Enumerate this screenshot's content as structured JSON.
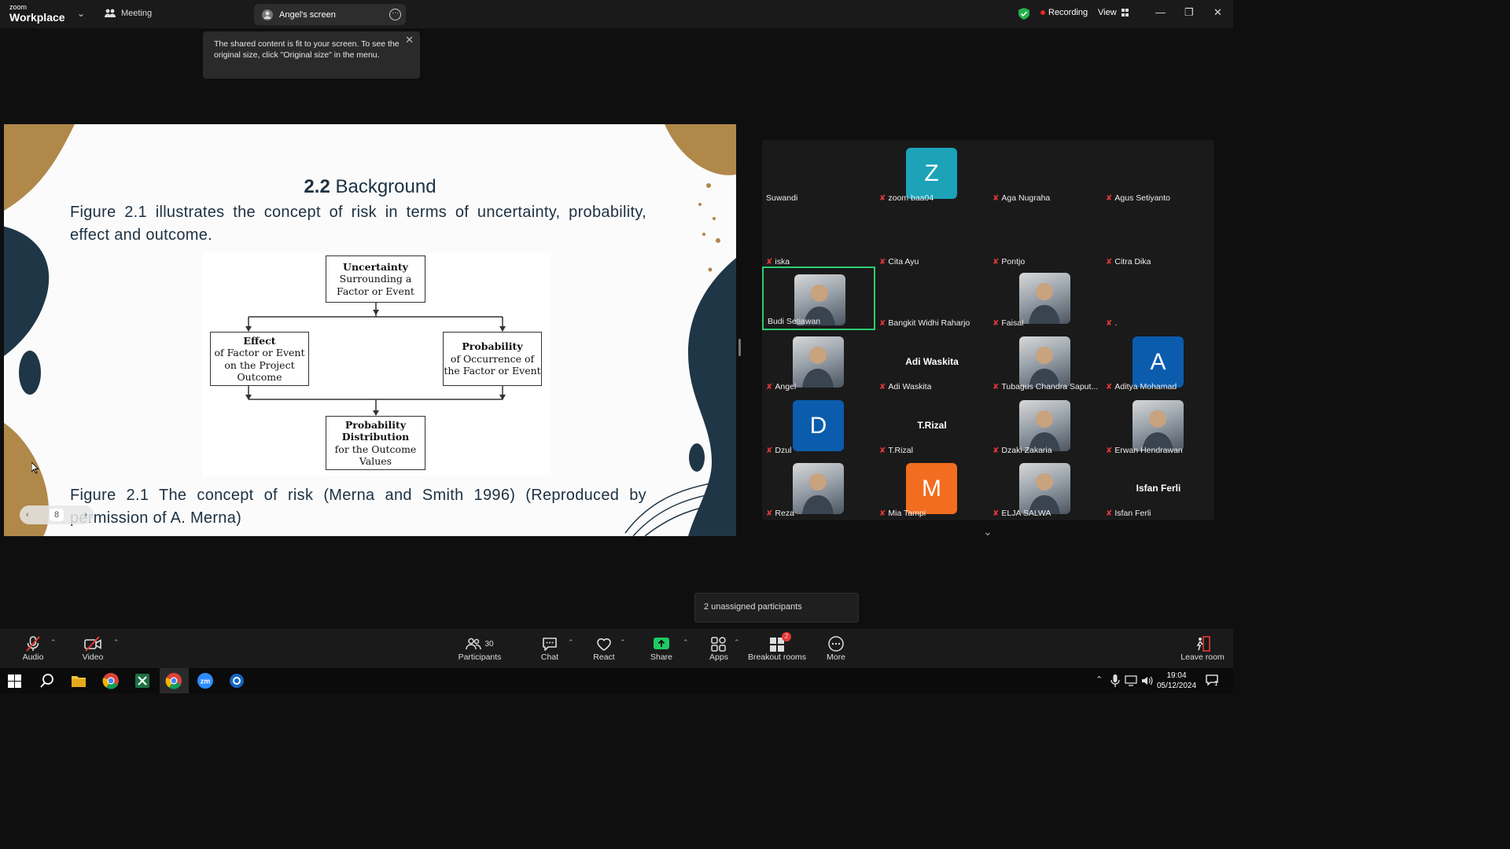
{
  "app": {
    "logo_top": "zoom",
    "logo_bottom": "Workplace"
  },
  "topbar": {
    "meeting_label": "Meeting",
    "screen_label": "Angel's screen",
    "recording_label": "Recording",
    "view_label": "View"
  },
  "tooltip": {
    "text": "The shared content is fit to your screen. To see the original size, click \"Original size\" in the menu."
  },
  "slide": {
    "title_num": "2.2",
    "title_text": "Background",
    "paragraph": "Figure 2.1 illustrates the concept of risk in terms of uncertainty, probability, effect and outcome.",
    "caption": "Figure 2.1 The concept of risk (Merna and Smith 1996) (Reproduced by permission of A. Merna)",
    "page_number": "8",
    "diagram": {
      "box1_bold": "Uncertainty",
      "box1_rest": "Surrounding a Factor or Event",
      "box2_bold": "Effect",
      "box2_rest": "of Factor or Event on the Project Outcome",
      "box3_bold": "Probability",
      "box3_rest": "of Occurrence of the Factor or Event",
      "box4_bold": "Probability Distribution",
      "box4_rest": "for the Outcome Values"
    }
  },
  "participants": [
    {
      "name": "Suwandi",
      "muted": false
    },
    {
      "name": "zoom baa04",
      "muted": true,
      "avatar": "Z",
      "color": "#1ca3b8"
    },
    {
      "name": "Aga Nugraha",
      "muted": true
    },
    {
      "name": "Agus Setiyanto",
      "muted": true
    },
    {
      "name": "iska",
      "muted": true
    },
    {
      "name": "Cita Ayu",
      "muted": true
    },
    {
      "name": "Pontjo",
      "muted": true
    },
    {
      "name": "Citra Dika",
      "muted": true
    },
    {
      "name": "Budi Setiawan",
      "muted": false,
      "active": true,
      "photo": true
    },
    {
      "name": "Bangkit Widhi Raharjo",
      "muted": true
    },
    {
      "name": "Faisal",
      "muted": true,
      "photo": true
    },
    {
      "name": ".",
      "muted": true
    },
    {
      "name": "Angel",
      "muted": true,
      "photo": true
    },
    {
      "name": "Adi Waskita",
      "muted": true,
      "display": "Adi Waskita"
    },
    {
      "name": "Tubagus Chandra Saput...",
      "muted": true,
      "photo": true
    },
    {
      "name": "Aditya Mohamad",
      "muted": true,
      "avatar": "A",
      "color": "#0b5cad"
    },
    {
      "name": "Dzul",
      "muted": true,
      "avatar": "D",
      "color": "#0b5cad"
    },
    {
      "name": "T.Rizal",
      "muted": true,
      "display": "T.Rizal"
    },
    {
      "name": "Dzaki Zakaria",
      "muted": true,
      "photo": true
    },
    {
      "name": "Erwan Hendrawan",
      "muted": true,
      "photo": true
    },
    {
      "name": "Reza",
      "muted": true,
      "photo": true
    },
    {
      "name": "Mia Tampi",
      "muted": true,
      "avatar": "M",
      "color": "#f26d1f"
    },
    {
      "name": "ELJA SALWA",
      "muted": true,
      "photo": true
    },
    {
      "name": "Isfan Ferli",
      "muted": true,
      "display": "Isfan Ferli"
    }
  ],
  "popup": {
    "text": "2 unassigned participants"
  },
  "toolbar": {
    "audio": "Audio",
    "video": "Video",
    "participants": "Participants",
    "participants_count": "30",
    "chat": "Chat",
    "react": "React",
    "share": "Share",
    "apps": "Apps",
    "breakout": "Breakout rooms",
    "breakout_badge": "2",
    "more": "More",
    "leave": "Leave room"
  },
  "taskbar": {
    "time": "19:04",
    "date": "05/12/2024",
    "notif_count": "1"
  }
}
